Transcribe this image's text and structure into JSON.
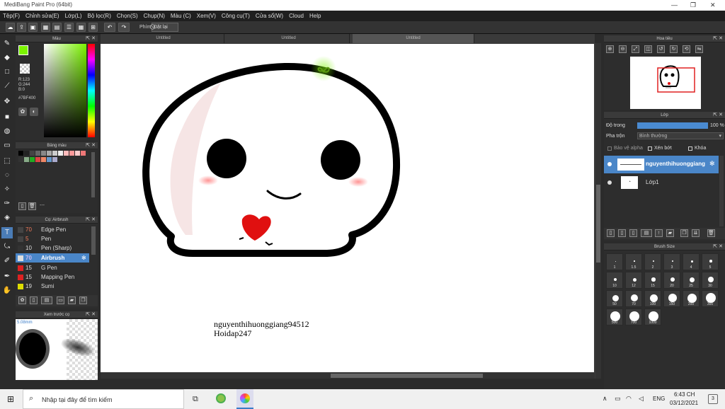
{
  "app_title": "MediBang Paint Pro (64bit)",
  "menu": [
    "Tệp(F)",
    "Chỉnh sửa(E)",
    "Lớp(L)",
    "Bộ lọc(R)",
    "Chọn(S)",
    "Chụp(N)",
    "Màu (C)",
    "Xem(V)",
    "Công cụ(T)",
    "Cửa sổ(W)",
    "Cloud",
    "Help"
  ],
  "toolbar": {
    "phim_label": "Phím",
    "reset_label": "Đặt lại"
  },
  "tabs": [
    "Untitled",
    "Untitled",
    "Untitled"
  ],
  "color_panel": {
    "title": "Màu",
    "r": "R:123",
    "g": "G:244",
    "b": "B:0",
    "hex": "#7BF400",
    "fg_color": "#7BF400"
  },
  "palette_panel": {
    "title": "Bảng màu",
    "footer_text": "---"
  },
  "brush_panel": {
    "title": "Cọ: Airbrush",
    "items": [
      {
        "size": "70",
        "name": "Edge Pen",
        "color": "#444"
      },
      {
        "size": "5",
        "name": "Pen",
        "color": "#444"
      },
      {
        "size": "10",
        "name": "Pen (Sharp)",
        "color": "#333"
      },
      {
        "size": "70",
        "name": "Airbrush",
        "color": "#ddd"
      },
      {
        "size": "15",
        "name": "G Pen",
        "color": "#d22"
      },
      {
        "size": "15",
        "name": "Mapping Pen",
        "color": "#d22"
      },
      {
        "size": "19",
        "name": "Sumi",
        "color": "#dd0"
      }
    ]
  },
  "preview_panel": {
    "title": "Xem trước cọ",
    "size_text": "5.08mm"
  },
  "navigator": {
    "title": "Hoa tiêu"
  },
  "layer_panel": {
    "title": "Lớp",
    "opacity_label": "Độ trong",
    "opacity_value": "100 %",
    "blend_label": "Pha trộn",
    "blend_value": "Bình thường",
    "protect_alpha": "Bảo vệ alpha",
    "clipping": "Xén bớt",
    "lock": "Khóa",
    "layers": [
      {
        "name": "nguyenthihuonggiang"
      },
      {
        "name": "Lớp1"
      }
    ]
  },
  "brush_size_panel": {
    "title": "Brush Size",
    "sizes": [
      "1",
      "1.5",
      "2",
      "3",
      "4",
      "5",
      "10",
      "12",
      "15",
      "20",
      "25",
      "30",
      "50",
      "70",
      "100",
      "150",
      "200",
      "300",
      "500",
      "700",
      "1000"
    ]
  },
  "canvas_text": {
    "line1": "nguyenthihuonggiang94512",
    "line2": "Hoidap247"
  },
  "taskbar": {
    "search_placeholder": "Nhập tại đây để tìm kiếm",
    "lang": "ENG",
    "time": "6:43 CH",
    "date": "03/12/2021",
    "badge": "3"
  }
}
